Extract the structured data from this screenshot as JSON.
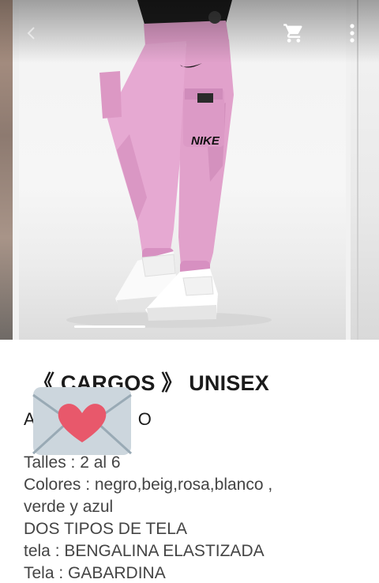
{
  "toolbar": {
    "back_icon": "chevron-left-icon",
    "cart_icon": "shopping-cart-icon",
    "menu_icon": "more-vert-icon"
  },
  "gallery": {
    "brand_swoosh_text": "NIKE"
  },
  "product": {
    "title": "《 CARGOS 》 UNISEX",
    "subtitle_visible": "A",
    "subtitle_tail": "O",
    "description": [
      "Talles : 2 al 6",
      "Colores :  negro,beig,rosa,blanco ,",
      "verde y azul",
      "DOS TIPOS DE TELA",
      "tela : BENGALINA ELASTIZADA",
      "Tela  : GABARDINA"
    ]
  },
  "overlay": {
    "icon": "love-letter-icon"
  },
  "colors": {
    "pants": "#e6a9d2",
    "accent_heart": "#e8586b",
    "envelope": "#ccd6dd"
  }
}
